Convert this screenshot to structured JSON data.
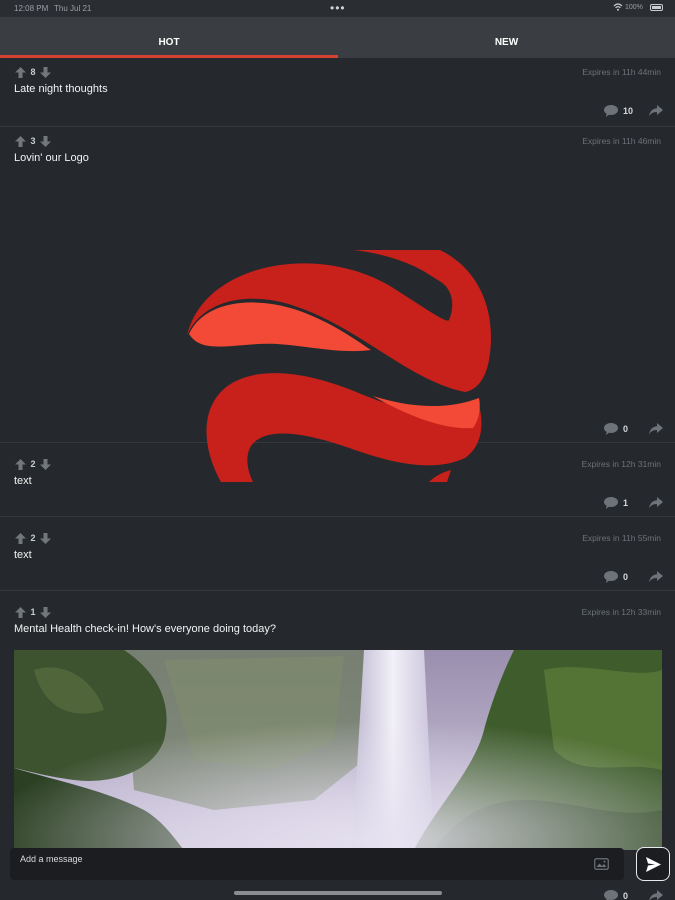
{
  "status_bar": {
    "time": "12:08 PM",
    "date": "Thu Jul 21",
    "multitask": "•••",
    "battery": "100%"
  },
  "tabs": [
    {
      "label": "HOT",
      "active": true
    },
    {
      "label": "NEW",
      "active": false
    }
  ],
  "posts": [
    {
      "votes": "8",
      "title": "Late night thoughts",
      "expires": "Expires in 11h 44min",
      "comments": "10"
    },
    {
      "votes": "3",
      "title": "Lovin' our Logo",
      "expires": "Expires in 11h 46min",
      "comments": "0",
      "media": "logo"
    },
    {
      "votes": "2",
      "title": "text",
      "expires": "Expires in 12h 31min",
      "comments": "1"
    },
    {
      "votes": "2",
      "title": "text",
      "expires": "Expires in 11h 55min",
      "comments": "0"
    },
    {
      "votes": "1",
      "title": "Mental Health check-in! How's everyone doing today?",
      "expires": "Expires in 12h 33min",
      "comments": "0",
      "media": "waterfall-photo"
    }
  ],
  "composer": {
    "placeholder": "Add a message"
  },
  "icons": {
    "upvote": "arrow-up-icon",
    "downvote": "arrow-down-icon",
    "comment": "comment-icon",
    "share": "share-icon",
    "image": "image-icon",
    "send": "send-icon"
  },
  "colors": {
    "background": "#25282c",
    "tab_bar": "#3a3d42",
    "accent": "#d8402f",
    "logo_dark": "#c8211b",
    "logo_light": "#f24a36"
  }
}
